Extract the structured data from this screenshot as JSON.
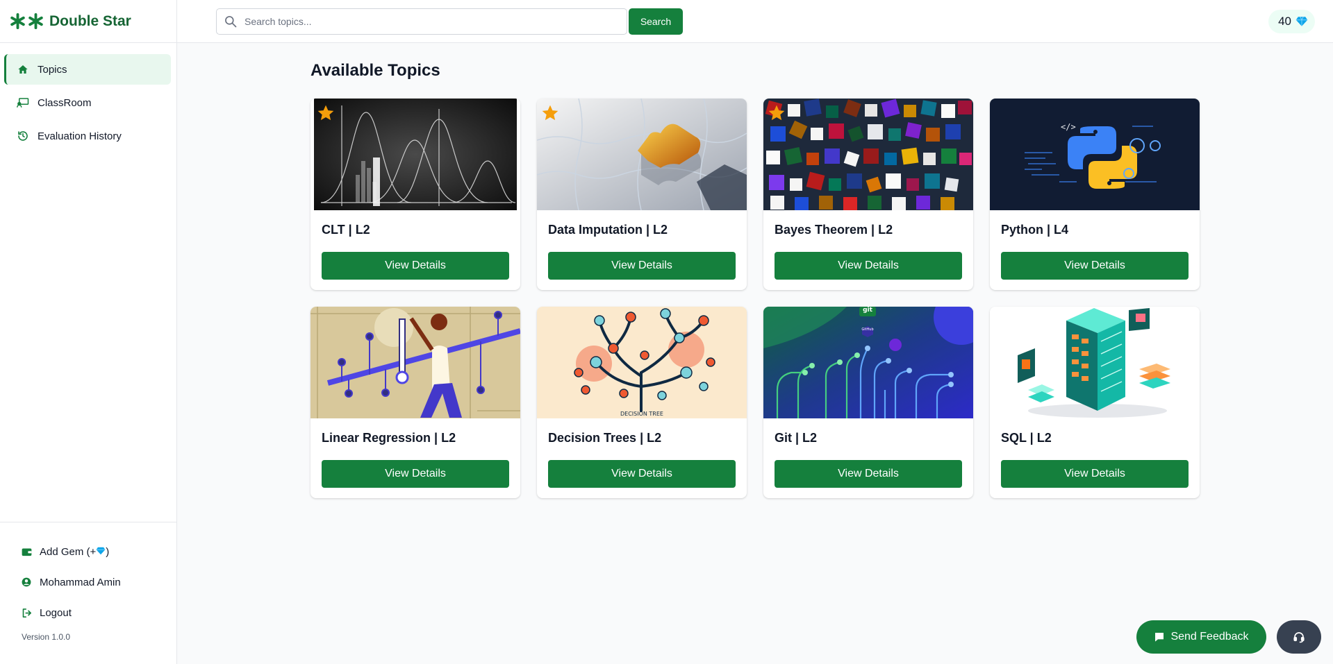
{
  "brand": {
    "title": "Double Star",
    "color": "#15803d"
  },
  "sidebar": {
    "items": [
      {
        "label": "Topics",
        "icon": "home-icon",
        "active": true
      },
      {
        "label": "ClassRoom",
        "icon": "classroom-icon",
        "active": false
      },
      {
        "label": "Evaluation History",
        "icon": "history-icon",
        "active": false
      }
    ],
    "bottom": {
      "add_gem": "Add Gem (+",
      "add_gem_suffix": ")",
      "user": "Mohammad Amin",
      "logout": "Logout",
      "version": "Version 1.0.0"
    }
  },
  "header": {
    "search_placeholder": "Search topics...",
    "search_button": "Search",
    "gem_count": "40"
  },
  "main": {
    "title": "Available Topics",
    "cards": [
      {
        "title": "CLT | L2",
        "button": "View Details",
        "starred": true,
        "image": "normal-distribution-chalkboard"
      },
      {
        "title": "Data Imputation | L2",
        "button": "View Details",
        "starred": true,
        "image": "golden-puzzle-piece"
      },
      {
        "title": "Bayes Theorem | L2",
        "button": "View Details",
        "starred": true,
        "image": "colorful-dice"
      },
      {
        "title": "Python | L4",
        "button": "View Details",
        "starred": false,
        "image": "python-logo-code"
      },
      {
        "title": "Linear Regression | L2",
        "button": "View Details",
        "starred": false,
        "image": "person-regression-line"
      },
      {
        "title": "Decision Trees | L2",
        "button": "View Details",
        "starred": false,
        "image": "decision-tree-illustration",
        "image_caption": "DECISION TREE"
      },
      {
        "title": "Git | L2",
        "button": "View Details",
        "starred": false,
        "image": "git-circuit-branches",
        "image_labels": [
          "git",
          "GitHub"
        ]
      },
      {
        "title": "SQL | L2",
        "button": "View Details",
        "starred": false,
        "image": "isometric-database-servers"
      }
    ]
  },
  "feedback": {
    "label": "Send Feedback"
  },
  "colors": {
    "primary": "#15803d",
    "gem": "#0ea5e9",
    "star": "#f59e0b"
  }
}
